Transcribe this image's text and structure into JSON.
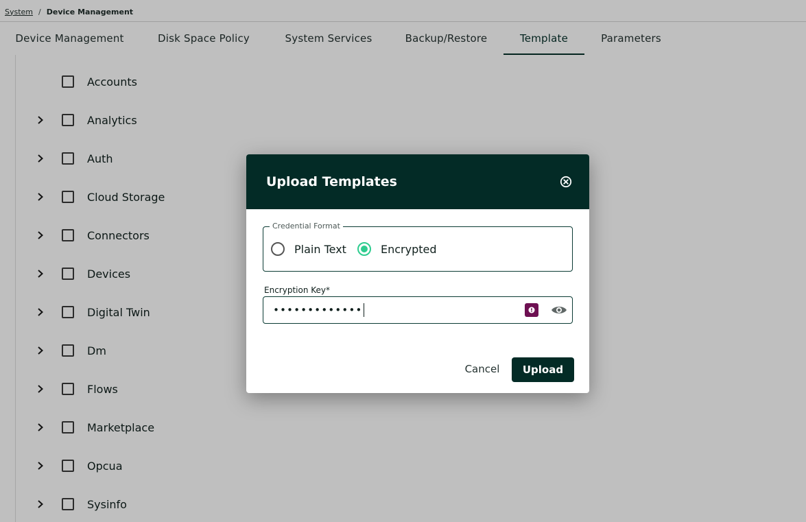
{
  "breadcrumb": {
    "root": "System",
    "separator": "/",
    "current": "Device Management"
  },
  "tabs": [
    {
      "label": "Device Management",
      "active": false
    },
    {
      "label": "Disk Space Policy",
      "active": false
    },
    {
      "label": "System Services",
      "active": false
    },
    {
      "label": "Backup/Restore",
      "active": false
    },
    {
      "label": "Template",
      "active": true
    },
    {
      "label": "Parameters",
      "active": false
    }
  ],
  "tree": {
    "items": [
      {
        "label": "Accounts",
        "expandable": false,
        "checked": false
      },
      {
        "label": "Analytics",
        "expandable": true,
        "checked": false
      },
      {
        "label": "Auth",
        "expandable": true,
        "checked": false
      },
      {
        "label": "Cloud Storage",
        "expandable": true,
        "checked": false
      },
      {
        "label": "Connectors",
        "expandable": true,
        "checked": false
      },
      {
        "label": "Devices",
        "expandable": true,
        "checked": false
      },
      {
        "label": "Digital Twin",
        "expandable": true,
        "checked": false
      },
      {
        "label": "Dm",
        "expandable": true,
        "checked": false
      },
      {
        "label": "Flows",
        "expandable": true,
        "checked": false
      },
      {
        "label": "Marketplace",
        "expandable": true,
        "checked": false
      },
      {
        "label": "Opcua",
        "expandable": true,
        "checked": false
      },
      {
        "label": "Sysinfo",
        "expandable": true,
        "checked": false
      }
    ]
  },
  "modal": {
    "title": "Upload Templates",
    "credential_format": {
      "legend": "Credential Format",
      "options": [
        {
          "label": "Plain Text",
          "selected": false
        },
        {
          "label": "Encrypted",
          "selected": true
        }
      ]
    },
    "encryption_key": {
      "label": "Encryption Key*",
      "masked_value": "•••••••••••••"
    },
    "cancel_label": "Cancel",
    "upload_label": "Upload"
  },
  "colors": {
    "primary_dark": "#032b26",
    "radio_accent": "#2ecc8f",
    "password_manager_badge": "#6e1052"
  }
}
